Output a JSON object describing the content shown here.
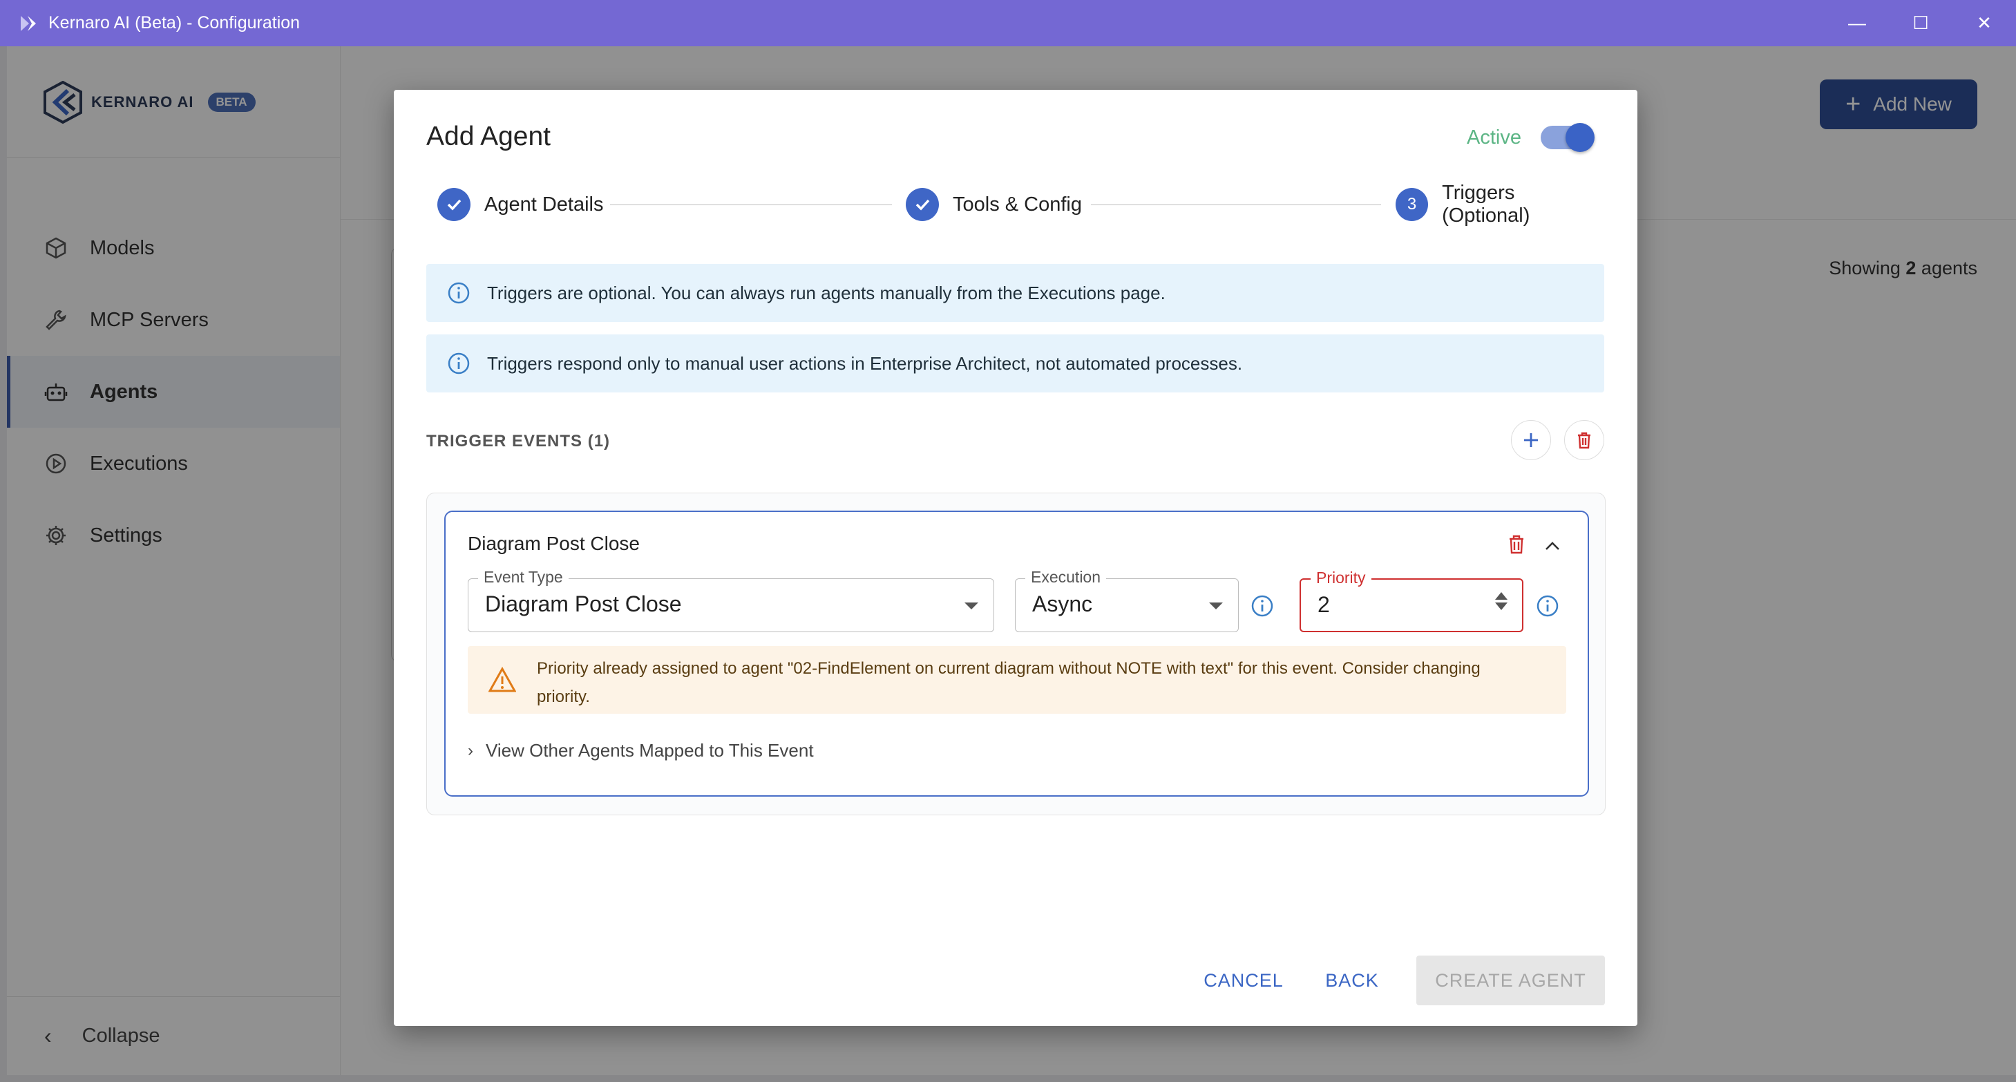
{
  "window": {
    "title": "Kernaro AI (Beta) - Configuration",
    "minimize": "—",
    "maximize": "☐",
    "close": "✕"
  },
  "brand": {
    "name": "KERNARO AI",
    "badge": "BETA"
  },
  "sidebar": {
    "items": [
      {
        "label": "Models",
        "icon": "cube-icon"
      },
      {
        "label": "MCP Servers",
        "icon": "wrench-icon"
      },
      {
        "label": "Agents",
        "icon": "robot-icon",
        "active": true
      },
      {
        "label": "Executions",
        "icon": "play-circle-icon"
      },
      {
        "label": "Settings",
        "icon": "gear-icon"
      }
    ],
    "collapse_label": "Collapse"
  },
  "main": {
    "add_new_label": "Add New",
    "showing_prefix": "Showing",
    "showing_count": "2",
    "showing_suffix": "agents"
  },
  "dialog": {
    "title": "Add Agent",
    "active_label": "Active",
    "active_on": true,
    "steps": [
      {
        "label": "Agent Details",
        "state": "done"
      },
      {
        "label": "Tools & Config",
        "state": "done"
      },
      {
        "label": "Triggers (Optional)",
        "state": "current",
        "number": "3"
      }
    ],
    "info_messages": [
      "Triggers are optional. You can always run agents manually from the Executions page.",
      "Triggers respond only to manual user actions in Enterprise Architect, not automated processes."
    ],
    "trigger_events_header": "TRIGGER EVENTS (1)",
    "event": {
      "title": "Diagram Post Close",
      "event_type_label": "Event Type",
      "event_type_value": "Diagram Post Close",
      "execution_label": "Execution",
      "execution_value": "Async",
      "priority_label": "Priority",
      "priority_value": "2",
      "warning": "Priority already assigned to agent \"02-FindElement on current diagram without NOTE with text\" for this event. Consider changing priority.",
      "view_other_label": "View Other Agents Mapped to This Event"
    },
    "buttons": {
      "cancel": "CANCEL",
      "back": "BACK",
      "create": "CREATE AGENT"
    }
  },
  "colors": {
    "titlebar": "#7468d3",
    "primary": "#3f66c6",
    "active_green": "#5cb585",
    "error_red": "#cf3030",
    "warning_bg": "#fdf3e6",
    "info_bg": "#e6f3fc"
  }
}
